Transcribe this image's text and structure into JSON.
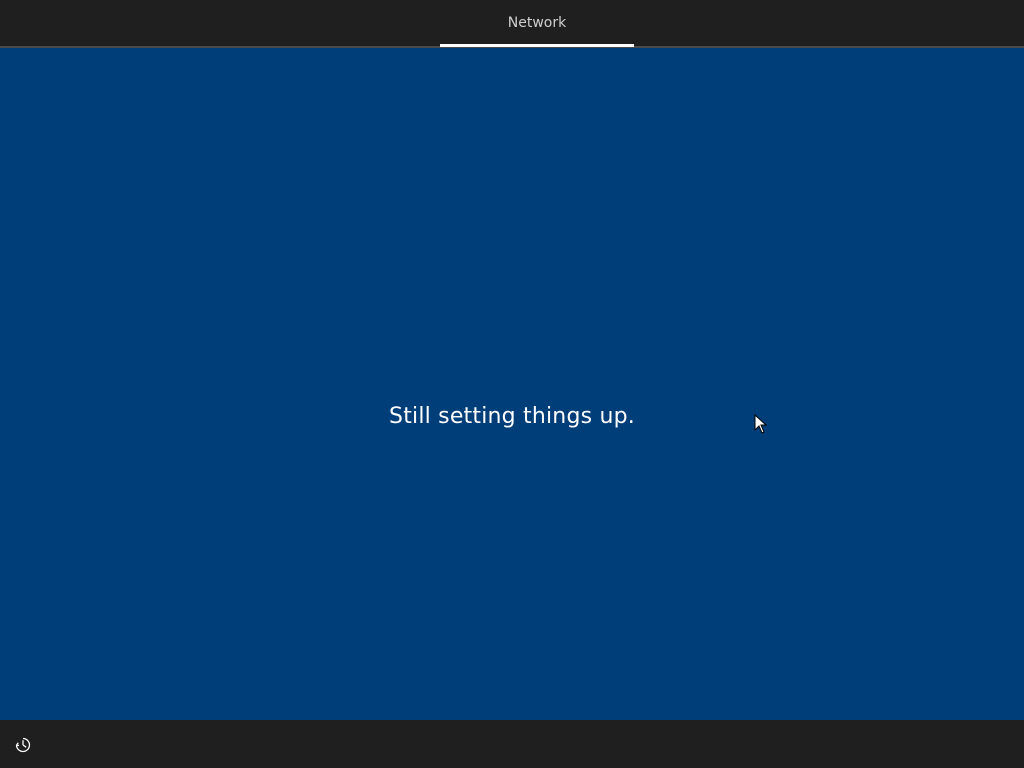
{
  "header": {
    "step_label": "Network"
  },
  "main": {
    "status_text": "Still setting things up."
  },
  "footer": {
    "accessibility_icon": "ease-of-access-icon"
  },
  "colors": {
    "background": "#003e7a",
    "bar": "#1f1f1f",
    "text": "#ffffff",
    "tab_text": "#cfcfcf"
  }
}
